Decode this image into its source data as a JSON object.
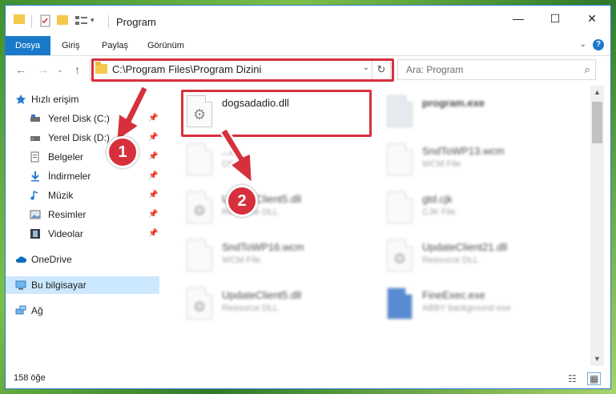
{
  "window": {
    "title": "Program",
    "controls": {
      "minimize": "—",
      "maximize": "☐",
      "close": "✕"
    }
  },
  "ribbon": {
    "tabs": [
      "Dosya",
      "Giriş",
      "Paylaş",
      "Görünüm"
    ],
    "active_tab": "Dosya",
    "help": "?"
  },
  "address_bar": {
    "path": "C:\\Program Files\\Program Dizini",
    "search_placeholder": "Ara: Program"
  },
  "sidebar": {
    "quick_access": "Hızlı erişim",
    "items": [
      {
        "label": "Yerel Disk (C:)",
        "icon": "drive-icon"
      },
      {
        "label": "Yerel Disk (D:)",
        "icon": "drive-icon"
      },
      {
        "label": "Belgeler",
        "icon": "documents-icon"
      },
      {
        "label": "İndirmeler",
        "icon": "download-icon"
      },
      {
        "label": "Müzik",
        "icon": "music-icon"
      },
      {
        "label": "Resimler",
        "icon": "pictures-icon"
      },
      {
        "label": "Videolar",
        "icon": "videos-icon"
      }
    ],
    "onedrive": "OneDrive",
    "this_pc": "Bu bilgisayar",
    "network": "Ağ"
  },
  "files": [
    {
      "name": "dogsadadio.dll",
      "type": "",
      "highlighted": true
    },
    {
      "name": "program.exe",
      "type": ""
    },
    {
      "name": "...ct",
      "type": "CK File"
    },
    {
      "name": "SndToWP13.wcm",
      "type": "WCM File"
    },
    {
      "name": "UpdateClient5.dll",
      "type": "Resource DLL"
    },
    {
      "name": "gtd.cjk",
      "type": "CJK File"
    },
    {
      "name": "SndToWP16.wcm",
      "type": "WCM File"
    },
    {
      "name": "UpdateClient21.dll",
      "type": "Resource DLL"
    },
    {
      "name": "UpdateClient5.dll",
      "type": "Resource DLL"
    },
    {
      "name": "FineExec.exe",
      "type": "ABBY background exe"
    }
  ],
  "status": {
    "item_count": "158 öğe"
  },
  "callouts": [
    "1",
    "2"
  ],
  "colors": {
    "accent": "#1979ca",
    "highlight": "#d6303d",
    "selected": "#cce8ff"
  }
}
